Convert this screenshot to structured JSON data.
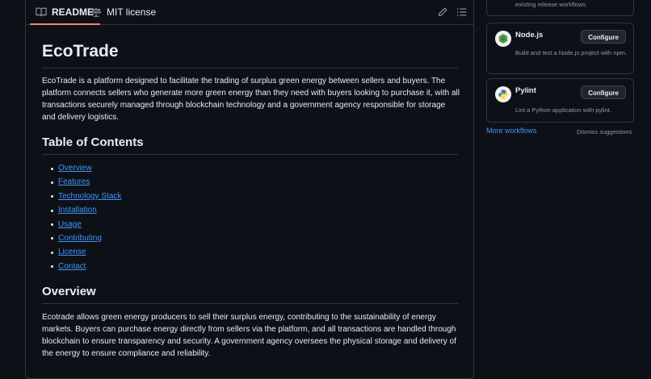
{
  "tabs": {
    "readme": "README",
    "license": "MIT license"
  },
  "icons": {
    "readme_tab": "book-icon",
    "license_tab": "scale-icon",
    "edit": "pencil-icon",
    "outline": "list-icon"
  },
  "readme": {
    "title": "EcoTrade",
    "intro": "EcoTrade is a platform designed to facilitate the trading of surplus green energy between sellers and buyers. The platform connects sellers who generate more green energy than they need with buyers looking to purchase it, with all transactions securely managed through blockchain technology and a government agency responsible for storage and delivery logistics.",
    "toc_heading": "Table of Contents",
    "toc": [
      "Overview",
      "Features",
      "Technology Stack",
      "Installation",
      "Usage",
      "Contributing",
      "License",
      "Contact"
    ],
    "overview_heading": "Overview",
    "overview_text": "Ecotrade allows green energy producers to sell their surplus energy, contributing to the sustainability of energy markets. Buyers can purchase energy directly from sellers via the platform, and all transactions are handled through blockchain to ensure transparency and security. A government agency oversees the physical storage and delivery of the energy to ensure compliance and reliability."
  },
  "sidebar": {
    "partial_card_text": "existing release workflows",
    "workflows": [
      {
        "name": "Node.js",
        "description": "Build and test a Node.js project with npm.",
        "button": "Configure",
        "icon": "nodejs-icon"
      },
      {
        "name": "Pylint",
        "description": "Lint a Python application with pylint.",
        "button": "Configure",
        "icon": "python-icon"
      }
    ],
    "more_workflows": "More workflows",
    "dismiss": "Dismiss suggestions"
  },
  "colors": {
    "background": "#0d1117",
    "border": "#30363d",
    "link": "#4493f8",
    "tab_underline": "#f78166"
  }
}
